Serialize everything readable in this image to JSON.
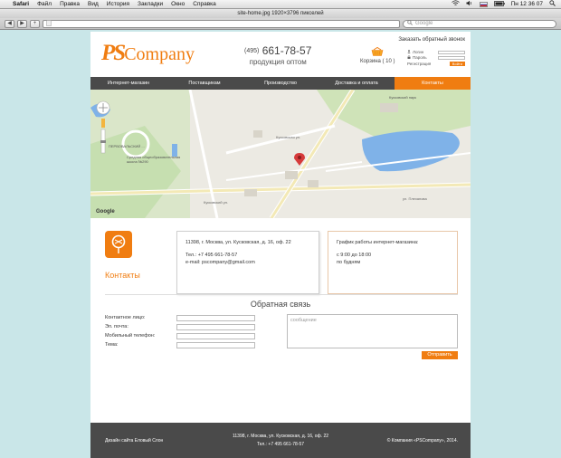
{
  "menubar": {
    "app": "Safari",
    "items": [
      "Файл",
      "Правка",
      "Вид",
      "История",
      "Закладки",
      "Окно",
      "Справка"
    ],
    "clock": "Пн 12 36 07"
  },
  "window": {
    "title": "site-home.jpg 1920×3796 пикселей",
    "search_placeholder": "Google",
    "back": "◀",
    "forward": "▶",
    "add": "+"
  },
  "header": {
    "logo_ps": "PS",
    "logo_company": "Company",
    "phone_code": "(495)",
    "phone_number": "661-78-57",
    "tagline": "продукция оптом",
    "cart_label": "Корзина ( 10 )",
    "callback": "Заказать обратный звонок",
    "login_label": "Логин",
    "password_label": "Пароль",
    "register": "Регистрация",
    "signin": "Войти"
  },
  "nav": {
    "tabs": [
      "Интернет-магазин",
      "Поставщикам",
      "Производство",
      "Доставка и оплата",
      "Контакты"
    ],
    "active": "Контакты"
  },
  "map": {
    "labels": {
      "park": "ПЕРВОВАЛЬСКИЙ ...",
      "school": "Средняя общеобразовательная школа №290",
      "mall": "Кусковский парк",
      "street1": "Кусковская ул.",
      "street2": "Кусковский ул.",
      "pond": "ул. Плеханова"
    },
    "brand": "Google"
  },
  "contact": {
    "title": "Контакты",
    "address": "11398, г. Москва, ул. Кусковская, д. 16, оф. 22",
    "phone": "Тел.: +7 495 661-78-57",
    "email": "e-mail: pscompany@gmail.com",
    "hours_title": "График работы интернет-магазина:",
    "hours": "с 9:00 до 18:00",
    "days": "по будням"
  },
  "feedback": {
    "title": "Обратная связь",
    "fields": [
      "Контактное лицо:",
      "Эл. почта:",
      "Мобильный телефон:",
      "Тема:"
    ],
    "message_placeholder": "сообщение",
    "send": "Отправить"
  },
  "footer": {
    "design": "Дизайн сайта Еловый Слон",
    "address": "11398, г. Москва, ул. Кусковская, д. 16, оф. 22",
    "phone": "Тел.: +7 495 661-78-57",
    "copyright": "© Компания «PSCompany», 2014."
  },
  "colors": {
    "accent": "#f07d11",
    "nav": "#4a4a4a",
    "background": "#c9e6e8"
  }
}
